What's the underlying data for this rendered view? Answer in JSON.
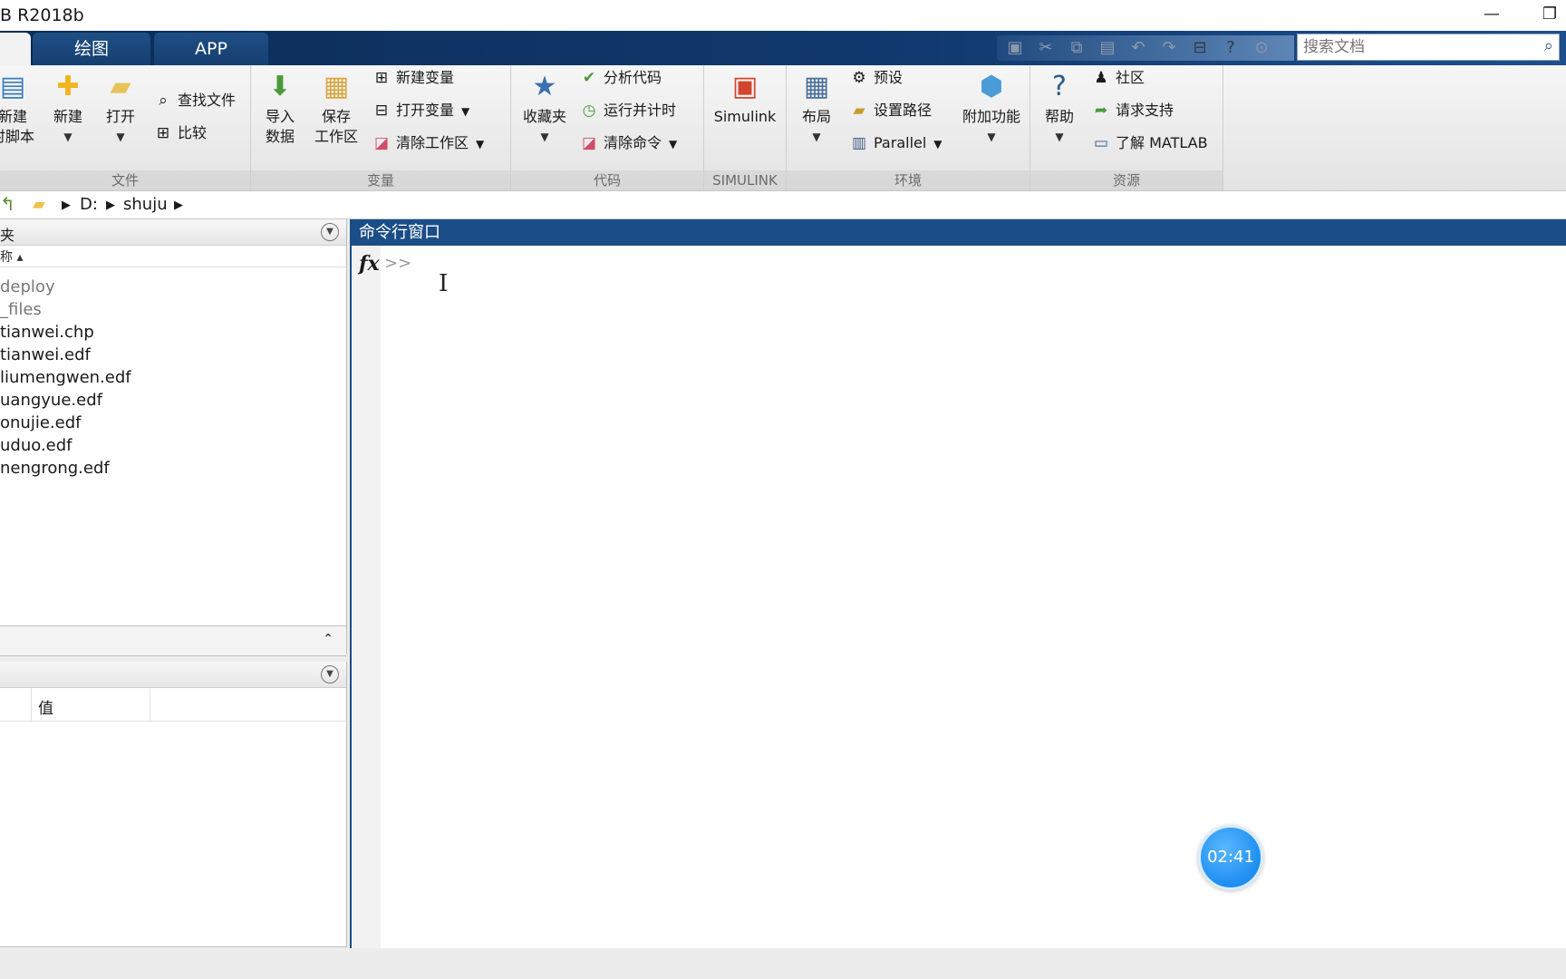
{
  "window": {
    "title": "B R2018b",
    "minimize_glyph": "—",
    "restore_glyph": "❐"
  },
  "tabs": [
    {
      "label": ""
    },
    {
      "label": "绘图"
    },
    {
      "label": "APP"
    }
  ],
  "search": {
    "placeholder": "搜索文档"
  },
  "ribbon": {
    "file": {
      "label": "文件",
      "new_script_line1": "新建",
      "new_script_line2": "时脚本",
      "new": "新建",
      "open": "打开",
      "find_files": "查找文件",
      "compare": "比较"
    },
    "variable": {
      "label": "变量",
      "import_line1": "导入",
      "import_line2": "数据",
      "save_line1": "保存",
      "save_line2": "工作区",
      "new_variable": "新建变量",
      "open_variable": "打开变量",
      "clear_workspace": "清除工作区"
    },
    "code": {
      "label": "代码",
      "favorites": "收藏夹",
      "analyze_code": "分析代码",
      "run_and_time": "运行并计时",
      "clear_commands": "清除命令"
    },
    "simulink": {
      "label": "SIMULINK",
      "button": "Simulink"
    },
    "environment": {
      "label": "环境",
      "layout": "布局",
      "preferences": "预设",
      "set_path": "设置路径",
      "parallel": "Parallel",
      "addons": "附加功能"
    },
    "resources": {
      "label": "资源",
      "help": "帮助",
      "community": "社区",
      "request_support": "请求支持",
      "learn_matlab": "了解 MATLAB"
    }
  },
  "address": {
    "drive": "D:",
    "folder": "shuju"
  },
  "current_folder": {
    "title_fragment": "夹",
    "name_header": "称 ▴",
    "files": [
      {
        "name": "deploy",
        "dim": true
      },
      {
        "name": "_files",
        "dim": true
      },
      {
        "name": "tianwei.chp",
        "dim": false
      },
      {
        "name": "tianwei.edf",
        "dim": false
      },
      {
        "name": "liumengwen.edf",
        "dim": false
      },
      {
        "name": "uangyue.edf",
        "dim": false
      },
      {
        "name": "onujie.edf",
        "dim": false
      },
      {
        "name": "uduo.edf",
        "dim": false
      },
      {
        "name": "nengrong.edf",
        "dim": false
      }
    ]
  },
  "workspace": {
    "value_header": "值"
  },
  "command_window": {
    "title": "命令行窗口",
    "fx": "fx",
    "prompt": ">>"
  },
  "timer": "02:41",
  "colors": {
    "accent": "#1b4d86",
    "tabstrip": "#11386d",
    "timer": "#1e8ef1"
  }
}
